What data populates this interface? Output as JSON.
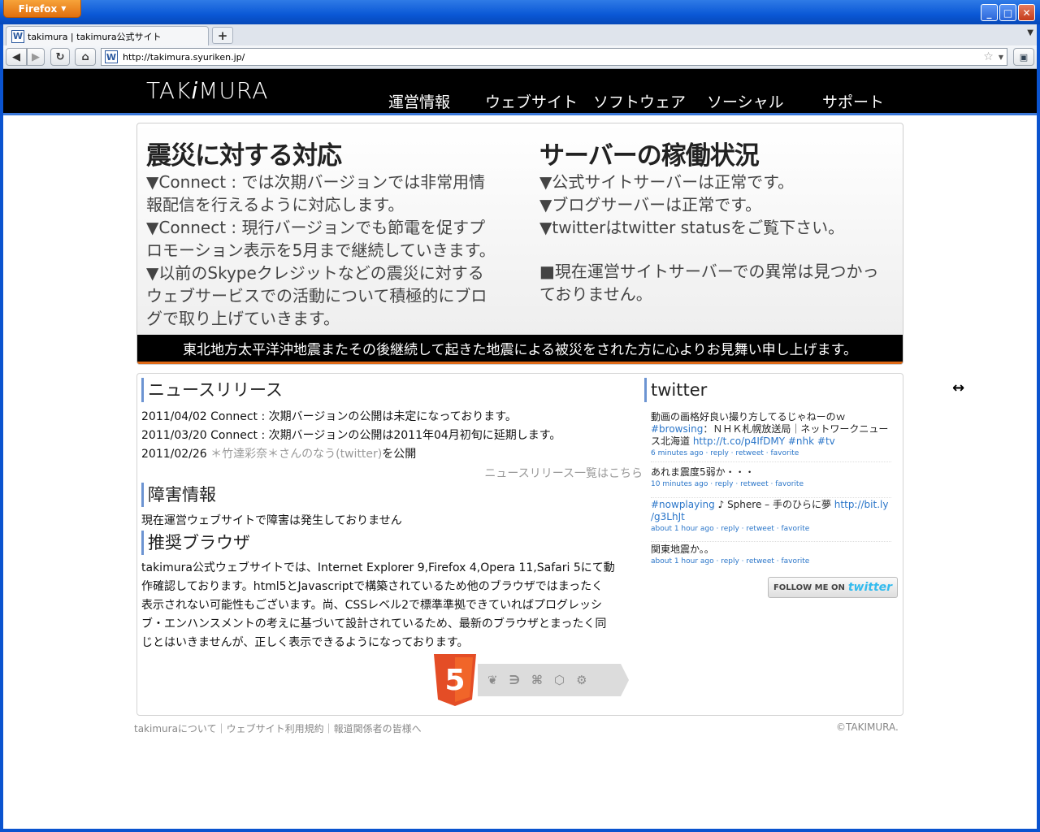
{
  "browser": {
    "menu_button": "Firefox",
    "tab_title": "takimura | takimura公式サイト",
    "new_tab": "+",
    "url": "http://takimura.syuriken.jp/",
    "favicon_glyph": "W"
  },
  "site": {
    "logo_pre": "TAK",
    "logo_i": "i",
    "logo_post": "MURA",
    "nav": [
      "運営情報",
      "ウェブサイト",
      "ソフトウェア",
      "ソーシャル",
      "サポート"
    ]
  },
  "hero": {
    "left_title": "震災に対する対応",
    "left_lines": [
      "▼Connect : では次期バージョンでは非常用情",
      "報配信を行えるように対応します。",
      "▼Connect : 現行バージョンでも節電を促すプ",
      "ロモーション表示を5月まで継続していきます。",
      "▼以前のSkypeクレジットなどの震災に対する",
      "ウェブサービスでの活動について積極的にブロ",
      "グで取り上げていきます。"
    ],
    "right_title": "サーバーの稼働状況",
    "right_lines": [
      "▼公式サイトサーバーは正常です。",
      "▼ブログサーバーは正常です。",
      "▼twitterはtwitter statusをご覧下さい。"
    ],
    "right_note_lines": [
      "■現在運営サイトサーバーでの異常は見つかっ",
      "ておりません。"
    ],
    "band": "東北地方太平洋沖地震またその後継続して起きた地震による被災をされた方に心よりお見舞い申し上げます。"
  },
  "news": {
    "title": "ニュースリリース",
    "items": [
      "2011/04/02 Connect : 次期バージョンの公開は未定になっております。",
      "2011/03/20 Connect : 次期バージョンの公開は2011年04月初旬に延期します。"
    ],
    "item3_date": "2011/02/26",
    "item3_link": "＊竹達彩奈＊さんのなう(twitter)",
    "item3_suffix": "を公開",
    "more": "ニュースリリース一覧はこちら"
  },
  "trouble": {
    "title": "障害情報",
    "text": "現在運営ウェブサイトで障害は発生しておりません"
  },
  "browser_rec": {
    "title": "推奨ブラウザ",
    "lines": [
      "takimura公式ウェブサイトでは、Internet Explorer 9,Firefox 4,Opera 11,Safari 5にて動",
      "作確認しております。html5とJavascriptで構築されているため他のブラウザではまったく",
      "表示されない可能性もございます。尚、CSSレベル2で標準準拠できていればプログレッシ",
      "ブ・エンハンスメントの考えに基づいて設計されているため、最新のブラウザとまったく同",
      "じとはいきませんが、正しく表示できるようになっております。"
    ],
    "badge_digit": "5"
  },
  "twitter": {
    "title": "twitter",
    "tweets": [
      {
        "line1": "動画の画格好良い撮り方してるじゃねーのｗ",
        "tag1": "#browsing",
        "line2": "：ＮＨＫ札幌放送局｜ネットワークニュー",
        "line3a": "ス北海道 ",
        "link": "http://t.co/p4IfDMY",
        "tags": "#nhk #tv",
        "meta": "6 minutes ago · reply · retweet · favorite"
      },
      {
        "line1": "あれま震度5弱か・・・",
        "meta": "10 minutes ago · reply · retweet · favorite"
      },
      {
        "tag1": "#nowplaying",
        "line1": " ♪ Sphere – 手のひらに夢 ",
        "link": "http://bit.ly",
        "link2": "/g3LhJt",
        "meta": "about 1 hour ago · reply · retweet · favorite"
      },
      {
        "line1": "関東地震か。。",
        "meta": "about 1 hour ago · reply · retweet · favorite"
      }
    ],
    "follow_prefix": "FOLLOW ME ON",
    "follow_logo": "twitter"
  },
  "footer": {
    "left": "takimuraについて｜ウェブサイト利用規約｜報道関係者の皆様へ",
    "right": "©TAKIMURA."
  },
  "colors": {
    "frame_blue": "#0a58d6",
    "header_black": "#000000",
    "accent_blue": "#3b78d8",
    "accent_orange": "#e06a17",
    "html5_orange": "#e44d26",
    "twitter_link": "#2b76c9"
  },
  "icons": [
    "back-icon",
    "forward-icon",
    "reload-icon",
    "home-icon",
    "bookmark-star-icon",
    "minimize-icon",
    "maximize-icon",
    "close-icon",
    "resize-cursor-icon"
  ]
}
